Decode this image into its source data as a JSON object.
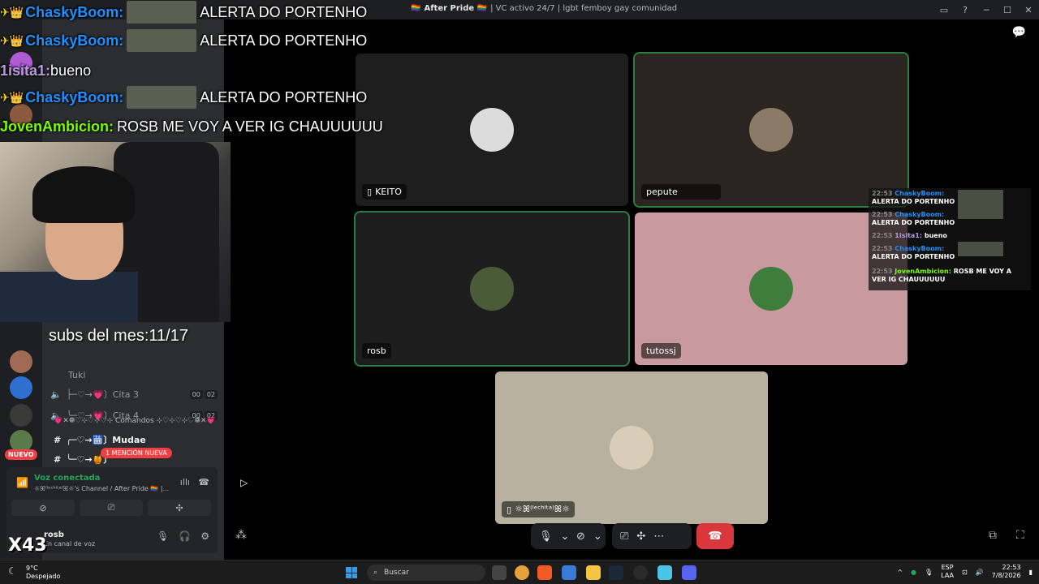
{
  "window": {
    "title_server": "After Pride 🏳️‍🌈",
    "title_rest": " | VC activo 24/7 | lgbt femboy gay comunidad"
  },
  "overlay_chat": [
    {
      "user": "ChaskyBoom:",
      "message": "ALERTA DO PORTENHO",
      "color": "blue"
    },
    {
      "user": "ChaskyBoom:",
      "message": "ALERTA DO PORTENHO",
      "color": "blue"
    },
    {
      "user": "1isita1:",
      "message": "bueno",
      "color": "purple"
    },
    {
      "user": "ChaskyBoom:",
      "message": "ALERTA DO PORTENHO",
      "color": "blue"
    },
    {
      "user": "JovenAmbicion:",
      "message": "ROSB ME VOY A VER IG CHAUUUUUU",
      "color": "green"
    }
  ],
  "stream_overlay": {
    "subs_text": "subs del mes:11/17",
    "multiplier": "X43"
  },
  "sidebar": {
    "guild_badge_new": "NUEVO",
    "voice_channels": [
      {
        "name": "├─♡→💗〕Cita 3",
        "a": "00",
        "b": "02"
      },
      {
        "name": "╰─♡→💗〕Cita 4",
        "a": "00",
        "b": "02"
      }
    ],
    "tuki_label": "Tuki",
    "category": "💗✕❁♡⊹♡⊹♡⊹ Comandos ⊹♡⊹♡⊹♡❁✕💗",
    "text_channels": [
      {
        "name": "╭─♡→🛗〕Mudae"
      },
      {
        "name": "╰─♡→🍯〕"
      }
    ],
    "mention_pill": "1 MENCIÓN NUEVA",
    "voice_connected": {
      "title": "Voz conectada",
      "subtitle": "☼ꕤ⁽ˡᵉᶜʰⁱᵗᵃ⁾ꕤ☼'s Channel / After Pride 🏳️‍🌈 |..."
    },
    "user": {
      "name": "rosb",
      "status": "En canal de voz"
    }
  },
  "tiles": [
    {
      "name": "KEITO",
      "bg": "#1e1e1e",
      "avatar": "#dcdcdc",
      "active": false
    },
    {
      "name": "pepute",
      "bg": "#2a2520",
      "avatar": "#8b7b66",
      "active": true
    },
    {
      "name": "rosb",
      "bg": "#1d1d1d",
      "avatar": "#4a5b38",
      "active": true
    },
    {
      "name": "tutossj",
      "bg": "#c8999e",
      "avatar": "#3f7d3c",
      "active": false
    },
    {
      "name": "☼ꕤ⁽ˡᵉᶜʰⁱᵗᵃ⁾ꕤ☼",
      "bg": "#b8b19f",
      "avatar": "#d9cdb8",
      "active": false
    }
  ],
  "mini_chat": [
    {
      "time": "22:53",
      "user": "ChaskyBoom:",
      "message": "ALERTA DO PORTENHO"
    },
    {
      "time": "22:53",
      "user": "ChaskyBoom:",
      "message": "ALERTA DO PORTENHO"
    },
    {
      "time": "22:53",
      "user": "1isita1:",
      "message": "bueno"
    },
    {
      "time": "22:53",
      "user": "ChaskyBoom:",
      "message": "ALERTA DO PORTENHO"
    },
    {
      "time": "22:53",
      "user": "JovenAmbicion:",
      "message": "ROSB ME VOY A VER IG CHAUUUUUU"
    }
  ],
  "taskbar": {
    "temp": "9°C",
    "weather": "Despejado",
    "search_placeholder": "Buscar",
    "lang_top": "ESP",
    "lang_bottom": "LAA",
    "time": "22:53",
    "date": "7/8/2026"
  },
  "colors": {
    "accent_green": "#23a55a",
    "hangup_red": "#da373c",
    "mention_red": "#f23f43"
  }
}
